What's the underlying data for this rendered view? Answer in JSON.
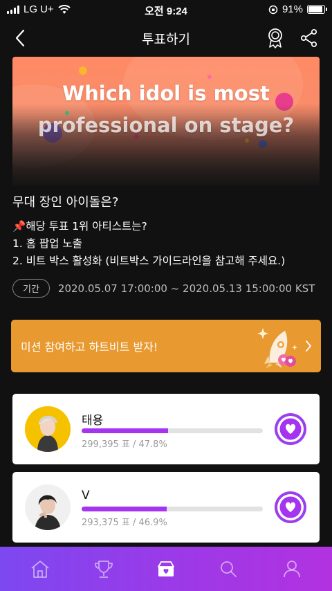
{
  "status_bar": {
    "carrier": "LG U+",
    "time": "오전 9:24",
    "battery": "91%",
    "battery_level": 0.91
  },
  "nav": {
    "title": "투표하기",
    "back_icon": "chevron-left-icon",
    "badge_icon": "award-badge-icon",
    "share_icon": "share-icon"
  },
  "banner": {
    "line1": "Which idol is most",
    "line2": "professional on stage?"
  },
  "vote": {
    "question": "무대 장인 아이돌은?",
    "description": [
      "📌해당 투표 1위 아티스트는?",
      "1. 홈 팝업 노출",
      "2. 비트 박스 활성화 (비트박스 가이드라인을 참고해 주세요.)"
    ],
    "period_label": "기간",
    "period": "2020.05.07 17:00:00 ~ 2020.05.13 15:00:00 KST"
  },
  "mission": {
    "label": "미션 참여하고 하트비트 받자!",
    "icon": "rocket-icon"
  },
  "candidates": [
    {
      "name": "태용",
      "votes": "299,395 표 / 47.8%",
      "share": 0.478
    },
    {
      "name": "V",
      "votes": "293,375 표 / 46.9%",
      "share": 0.469
    }
  ],
  "tabbar": {
    "items": [
      "home-icon",
      "trophy-icon",
      "vote-box-icon",
      "search-icon",
      "profile-icon"
    ],
    "active_index": 2
  },
  "colors": {
    "accent": "#a434f0",
    "mission": "#e8992f",
    "background": "#111111"
  }
}
